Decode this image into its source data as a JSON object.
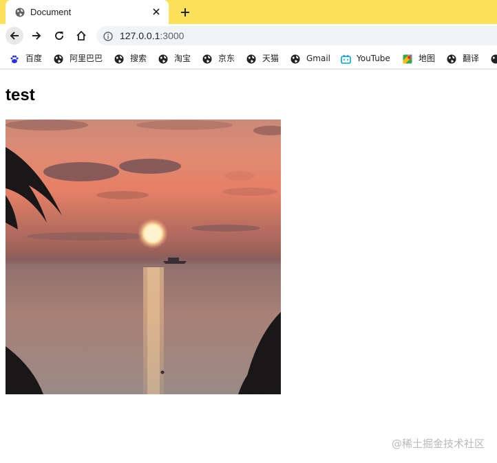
{
  "tab": {
    "title": "Document",
    "close_icon": "close-icon",
    "favicon": "globe-icon"
  },
  "toolbar": {
    "url_host": "127.0.0.1",
    "url_port": ":3000"
  },
  "bookmarks": [
    {
      "label": "百度",
      "icon": "baidu-paw-icon"
    },
    {
      "label": "阿里巴巴",
      "icon": "globe-icon"
    },
    {
      "label": "搜索",
      "icon": "globe-icon"
    },
    {
      "label": "淘宝",
      "icon": "globe-icon"
    },
    {
      "label": "京东",
      "icon": "globe-icon"
    },
    {
      "label": "天猫",
      "icon": "globe-icon"
    },
    {
      "label": "Gmail",
      "icon": "globe-icon"
    },
    {
      "label": "YouTube",
      "icon": "bilibili-tv-icon"
    },
    {
      "label": "地图",
      "icon": "maps-pin-icon"
    },
    {
      "label": "翻译",
      "icon": "globe-icon"
    }
  ],
  "page": {
    "heading": "test",
    "image_subject": "sunset over the sea with palm fronds"
  },
  "watermark": "@稀土掘金技术社区",
  "colors": {
    "tab_strip": "#fde15a",
    "omnibox": "#f1f3f4"
  }
}
